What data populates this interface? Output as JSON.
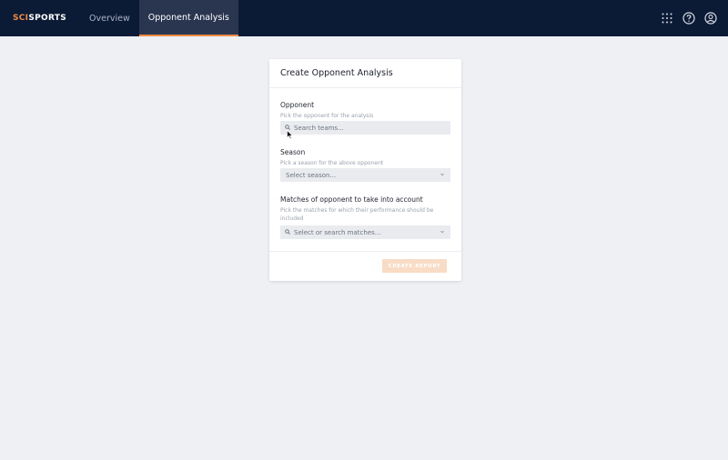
{
  "brand": {
    "part1": "SCI",
    "part2": "SPORTS"
  },
  "nav": {
    "tabs": [
      {
        "label": "Overview",
        "active": false
      },
      {
        "label": "Opponent Analysis",
        "active": true
      }
    ],
    "icons": [
      "apps-grid-icon",
      "help-icon",
      "account-icon"
    ]
  },
  "form": {
    "title": "Create Opponent Analysis",
    "opponent": {
      "label": "Opponent",
      "help": "Pick the opponent for the analysis",
      "placeholder": "Search teams..."
    },
    "season": {
      "label": "Season",
      "help": "Pick a season for the above opponent",
      "placeholder": "Select season..."
    },
    "matches": {
      "label": "Matches of opponent to take into account",
      "help_line1": "Pick the matches for which their performance should be",
      "help_line2": "included",
      "placeholder": "Select or search matches..."
    },
    "submit_label": "CREATE REPORT"
  },
  "colors": {
    "topbar": "#0c1b35",
    "accent": "#f08a46",
    "disabled_button": "#f9dcc6",
    "background": "#eef0f4"
  }
}
